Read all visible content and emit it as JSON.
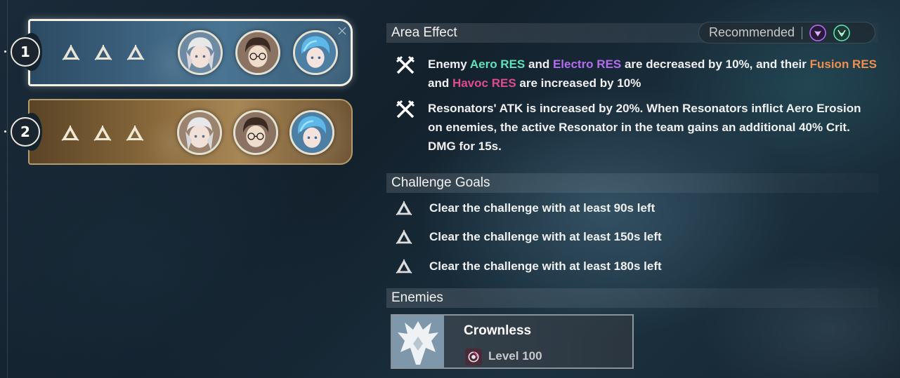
{
  "teams": [
    {
      "number": "1",
      "selected": true,
      "stars": 3,
      "avatars": [
        "white-haired-resonator",
        "dark-haired-resonator-glasses",
        "blue-haired-resonator"
      ]
    },
    {
      "number": "2",
      "selected": false,
      "stars": 3,
      "avatars": [
        "white-haired-resonator",
        "dark-haired-resonator-glasses",
        "blue-haired-resonator"
      ]
    }
  ],
  "area_effect": {
    "title": "Area Effect",
    "recommended_label": "Recommended",
    "recommended_icons": [
      "havoc-element-icon",
      "aero-element-icon"
    ],
    "effects": [
      {
        "icon": "crossed-swords-icon",
        "parts": [
          {
            "text": "Enemy ",
            "color": ""
          },
          {
            "text": "Aero RES",
            "color": "aero"
          },
          {
            "text": " and ",
            "color": ""
          },
          {
            "text": "Electro RES",
            "color": "electro"
          },
          {
            "text": " are decreased by 10%, and their ",
            "color": ""
          },
          {
            "text": "Fusion RES",
            "color": "fusion"
          },
          {
            "text": " and ",
            "color": ""
          },
          {
            "text": "Havoc RES",
            "color": "havoc"
          },
          {
            "text": " are increased by 10%",
            "color": ""
          }
        ]
      },
      {
        "icon": "crossed-swords-icon",
        "text": "Resonators' ATK is increased by 20%. When Resonators inflict Aero Erosion on enemies, the active Resonator in the team gains an additional 40% Crit. DMG for 15s."
      }
    ]
  },
  "challenge_goals": {
    "title": "Challenge Goals",
    "goals": [
      "Clear the challenge with at least 90s left",
      "Clear the challenge with at least 150s left",
      "Clear the challenge with at least 180s left"
    ]
  },
  "enemies": {
    "title": "Enemies",
    "list": [
      {
        "name": "Crownless",
        "level": "Level 100",
        "element_icon": "havoc-element-icon"
      }
    ]
  },
  "colors": {
    "aero": "#5ee3b8",
    "electro": "#b46cf0",
    "fusion": "#f08f4e",
    "havoc": "#e04b8e"
  }
}
